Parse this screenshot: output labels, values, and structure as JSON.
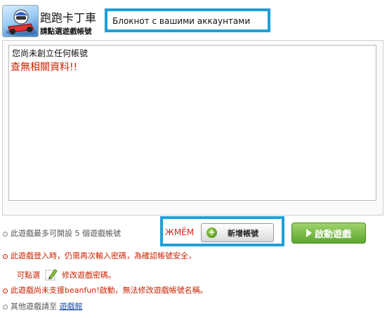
{
  "header": {
    "game_title": "跑跑卡丁車",
    "subtitle": "請點選遊戲帳號"
  },
  "annotation": {
    "notepad_label": "Блокнот с вашими аккаунтами",
    "press_label": "ЖМЁМ"
  },
  "account_list": {
    "empty_message": "您尚未創立任何帳號",
    "no_data_message": "查無相關資料!!"
  },
  "actions": {
    "limit_note": "此遊戲最多可開設 5 個遊戲帳號",
    "add_account_label": "新增帳號",
    "start_game_label": "啟動遊戲"
  },
  "notes": {
    "login_note": "此遊戲登入時，仍需再次輸入密碼，為確認帳號安全，",
    "click_select": "可點選",
    "modify_password": "修改遊戲密碼。",
    "beanfun_note": "此遊戲尚未支援beanfun!啟動，無法修改遊戲帳號名稱。",
    "other_games_prefix": "其他遊戲請至",
    "arcade_link": "遊戲館"
  },
  "colors": {
    "annotation_border": "#1fa0d8",
    "warning_red": "#cc2200",
    "start_green": "#6cb33a",
    "link_blue": "#1c4aa8"
  },
  "icons": [
    "game-logo",
    "plus-icon",
    "play-icon",
    "pencil-icon",
    "bullet-icon"
  ]
}
